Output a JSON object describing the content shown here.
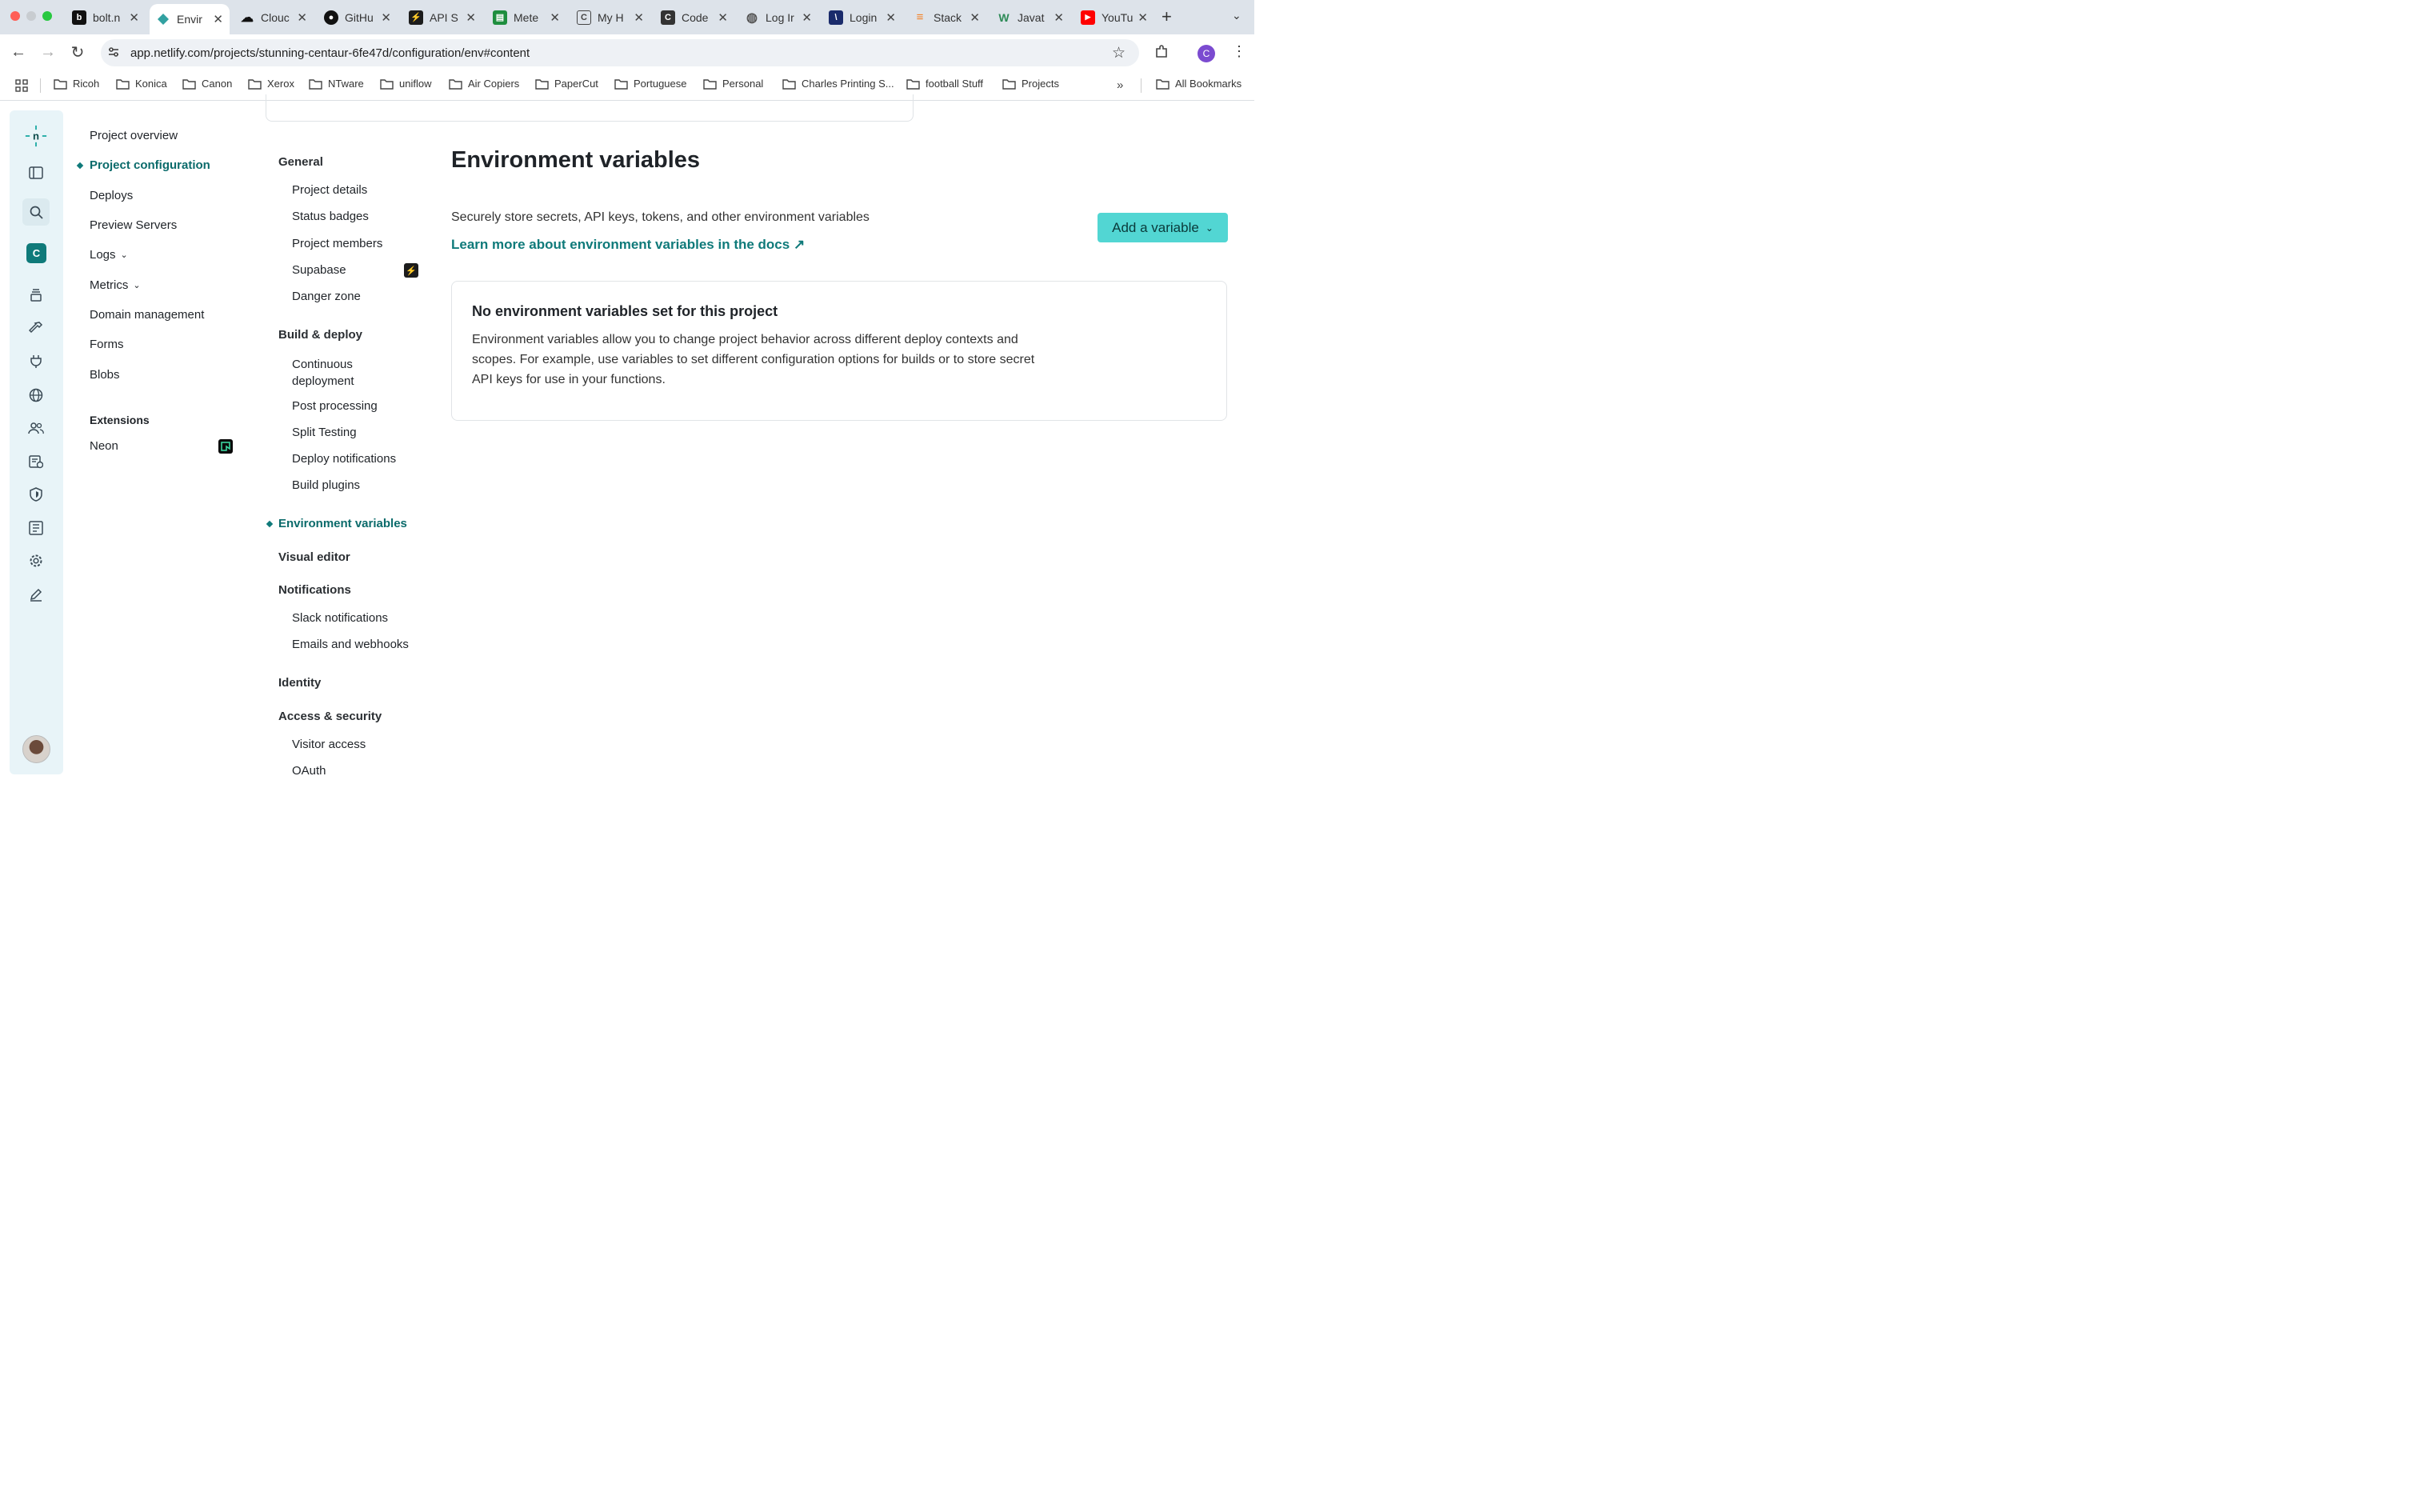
{
  "browser": {
    "tabs": [
      {
        "label": "bolt.n",
        "icon": "bolt-icon",
        "color": "#111111"
      },
      {
        "label": "Envir",
        "icon": "netlify-icon",
        "color": "#32a1a1",
        "active": true
      },
      {
        "label": "Clouc",
        "icon": "cloud-icon",
        "color": "#111111"
      },
      {
        "label": "GitHu",
        "icon": "github-icon",
        "color": "#111111"
      },
      {
        "label": "API S",
        "icon": "supabase-icon",
        "color": "#1c1c1c"
      },
      {
        "label": "Mete",
        "icon": "sheet-icon",
        "color": "#1e8e3e"
      },
      {
        "label": "My H",
        "icon": "doc-icon",
        "color": "#444444"
      },
      {
        "label": "Code",
        "icon": "code-icon",
        "color": "#333333"
      },
      {
        "label": "Log Ir",
        "icon": "globe-icon",
        "color": "#555555"
      },
      {
        "label": "Login",
        "icon": "vercel-icon",
        "color": "#1a2b6b"
      },
      {
        "label": "Stack",
        "icon": "stackoverflow-icon",
        "color": "#f48024"
      },
      {
        "label": "Javat",
        "icon": "w-icon",
        "color": "#2e8b57"
      },
      {
        "label": "YouTu",
        "icon": "youtube-icon",
        "color": "#ff0000"
      }
    ],
    "url": "app.netlify.com/projects/stunning-centaur-6fe47d/configuration/env#content",
    "bookmarks": [
      "Ricoh",
      "Konica",
      "Canon",
      "Xerox",
      "NTware",
      "uniflow",
      "Air Copiers",
      "PaperCut",
      "Portuguese",
      "Personal",
      "Charles Printing S...",
      "football Stuff",
      "Projects"
    ],
    "all_bookmarks": "All Bookmarks",
    "profile_initial": "C"
  },
  "rail": {
    "team_initial": "C",
    "accent": "#16a6a0"
  },
  "nav": {
    "items": [
      "Project overview",
      "Project configuration",
      "Deploys",
      "Preview Servers",
      "Logs",
      "Metrics",
      "Domain management",
      "Forms",
      "Blobs"
    ],
    "extensions_header": "Extensions",
    "extensions": [
      "Neon"
    ]
  },
  "settings_nav": {
    "general": "General",
    "general_items": [
      "Project details",
      "Status badges",
      "Project members",
      "Supabase",
      "Danger zone"
    ],
    "build": "Build & deploy",
    "build_items": [
      "Continuous deployment",
      "Post processing",
      "Split Testing",
      "Deploy notifications",
      "Build plugins"
    ],
    "env": "Environment variables",
    "visual": "Visual editor",
    "notifications": "Notifications",
    "notification_items": [
      "Slack notifications",
      "Emails and webhooks"
    ],
    "identity": "Identity",
    "access": "Access & security",
    "access_items": [
      "Visitor access",
      "OAuth"
    ]
  },
  "main": {
    "title": "Environment variables",
    "description": "Securely store secrets, API keys, tokens, and other environment variables",
    "doc_link": "Learn more about environment variables in the docs ↗",
    "add_button": "Add a variable",
    "empty_title": "No environment variables set for this project",
    "empty_body": "Environment variables allow you to change project behavior across different deploy contexts and scopes. For example, use variables to set different configuration options for builds or to store secret API keys for use in your functions."
  }
}
